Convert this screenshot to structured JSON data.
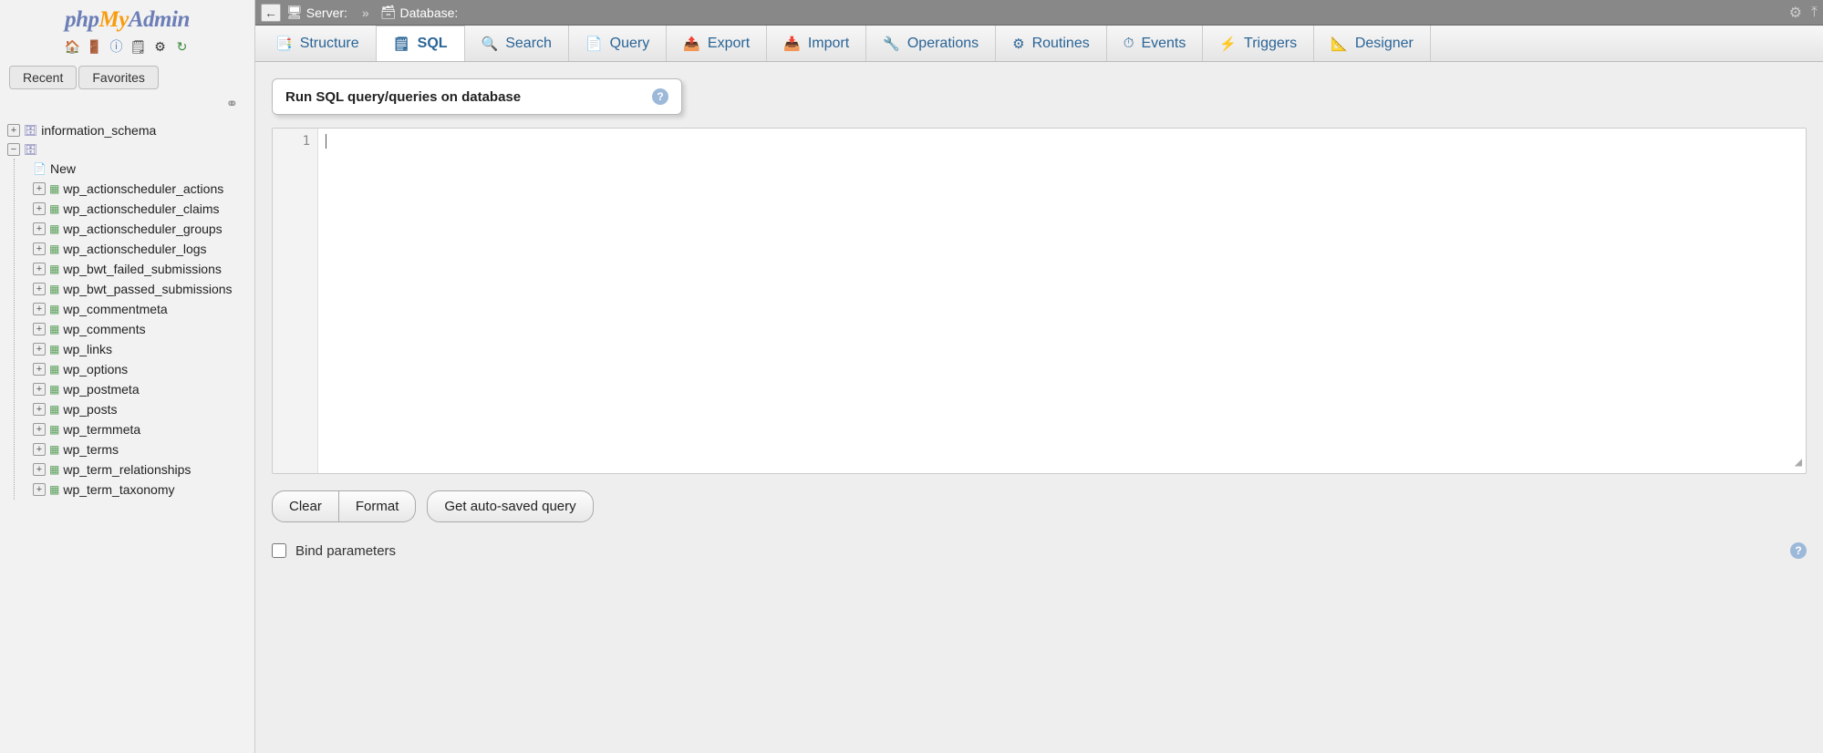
{
  "logo": {
    "php": "php",
    "my": "My",
    "admin": "Admin"
  },
  "sidebar": {
    "recent": "Recent",
    "favorites": "Favorites",
    "dbs": [
      {
        "name": "information_schema",
        "expanded": false
      }
    ],
    "current_db": {
      "new": "New",
      "tables": [
        "wp_actionscheduler_actions",
        "wp_actionscheduler_claims",
        "wp_actionscheduler_groups",
        "wp_actionscheduler_logs",
        "wp_bwt_failed_submissions",
        "wp_bwt_passed_submissions",
        "wp_commentmeta",
        "wp_comments",
        "wp_links",
        "wp_options",
        "wp_postmeta",
        "wp_posts",
        "wp_termmeta",
        "wp_terms",
        "wp_term_relationships",
        "wp_term_taxonomy"
      ]
    }
  },
  "breadcrumb": {
    "server_label": "Server:",
    "server_name": "",
    "db_label": "Database:",
    "db_name": ""
  },
  "tabs": [
    {
      "icon": "📑",
      "label": "Structure"
    },
    {
      "icon": "🗒",
      "label": "SQL",
      "active": true
    },
    {
      "icon": "🔍",
      "label": "Search"
    },
    {
      "icon": "📄",
      "label": "Query"
    },
    {
      "icon": "📤",
      "label": "Export"
    },
    {
      "icon": "📥",
      "label": "Import"
    },
    {
      "icon": "🔧",
      "label": "Operations"
    },
    {
      "icon": "⚙",
      "label": "Routines"
    },
    {
      "icon": "⏱",
      "label": "Events"
    },
    {
      "icon": "⚡",
      "label": "Triggers"
    },
    {
      "icon": "📐",
      "label": "Designer"
    }
  ],
  "panel": {
    "title": "Run SQL query/queries on database"
  },
  "editor": {
    "line1": "1",
    "content": ""
  },
  "buttons": {
    "clear": "Clear",
    "format": "Format",
    "autosaved": "Get auto-saved query"
  },
  "bind": {
    "label": "Bind parameters"
  }
}
